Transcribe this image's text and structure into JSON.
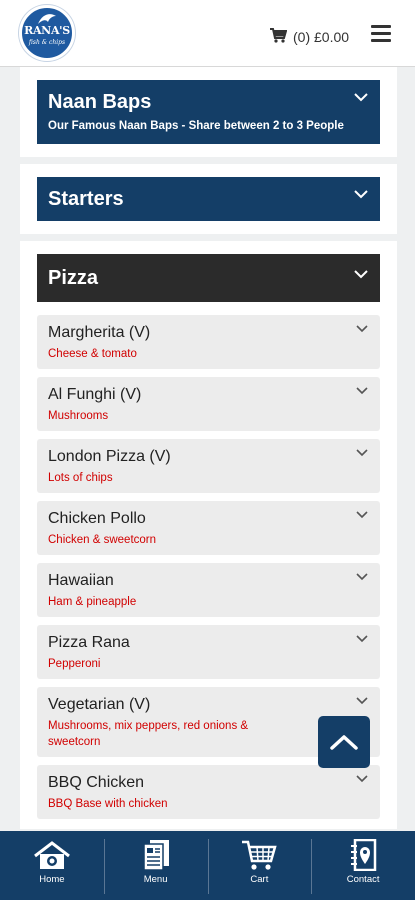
{
  "header": {
    "logo_text": "RANA'S",
    "logo_sub": "fish & chips",
    "cart_summary": "(0) £0.00",
    "cart_icon": "shopping-cart-icon",
    "menu_icon": "hamburger-menu-icon"
  },
  "categories": [
    {
      "title": "Naan Baps",
      "subtitle": "Our Famous Naan Baps - Share between 2 to 3 People"
    },
    {
      "title": "Starters",
      "subtitle": ""
    },
    {
      "title": "Pizza",
      "subtitle": ""
    }
  ],
  "pizza_items": [
    {
      "name": "Margherita (V)",
      "desc": "Cheese & tomato"
    },
    {
      "name": "Al Funghi (V)",
      "desc": "Mushrooms"
    },
    {
      "name": "London Pizza (V)",
      "desc": "Lots of chips"
    },
    {
      "name": "Chicken Pollo",
      "desc": "Chicken & sweetcorn"
    },
    {
      "name": "Hawaiian",
      "desc": "Ham & pineapple"
    },
    {
      "name": "Pizza Rana",
      "desc": "Pepperoni"
    },
    {
      "name": "Vegetarian (V)",
      "desc": "Mushrooms, mix peppers, red onions & sweetcorn"
    },
    {
      "name": "BBQ Chicken",
      "desc": "BBQ Base with chicken"
    }
  ],
  "bottom_nav": [
    {
      "label": "Home",
      "icon": "home-icon"
    },
    {
      "label": "Menu",
      "icon": "menu-book-icon"
    },
    {
      "label": "Cart",
      "icon": "cart-icon"
    },
    {
      "label": "Contact",
      "icon": "contact-pin-icon"
    }
  ],
  "scroll_top_icon": "chevron-up-icon",
  "colors": {
    "primary": "#143e67",
    "dark_header": "#2b2b2b",
    "accent_red": "#d10000",
    "page_bg": "#eef0f1"
  }
}
